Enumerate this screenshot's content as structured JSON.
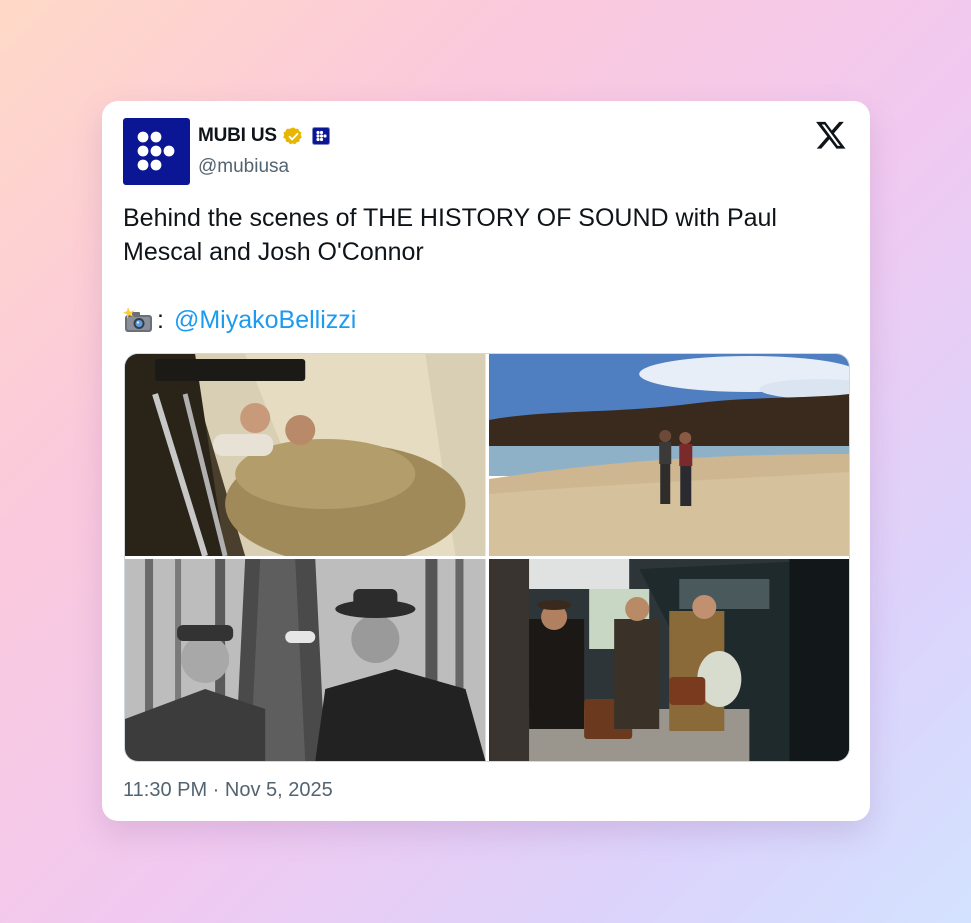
{
  "account": {
    "display_name": "MUBI US",
    "handle": "@mubiusa",
    "verified_badge_icon": "gold-verified-badge-icon",
    "affiliate_icon": "mubi-affiliate-badge-icon"
  },
  "tweet": {
    "text_line1": "Behind the scenes of THE HISTORY OF SOUND with Paul",
    "text_line2": "Mescal and Josh O'Connor",
    "credit_separator": ":",
    "credit_mention": "@MiyakoBellizzi",
    "camera_icon": "camera-flash-icon"
  },
  "media": {
    "photos": [
      "photo-tent",
      "photo-beach",
      "photo-forest",
      "photo-train-platform"
    ]
  },
  "timestamp": "11:30 PM · Nov 5, 2025",
  "colors": {
    "mention": "#1d9bf0",
    "avatar_bg": "#0a1694",
    "badge_gold": "#e8b500",
    "text": "#0f1419",
    "muted": "#536471"
  }
}
